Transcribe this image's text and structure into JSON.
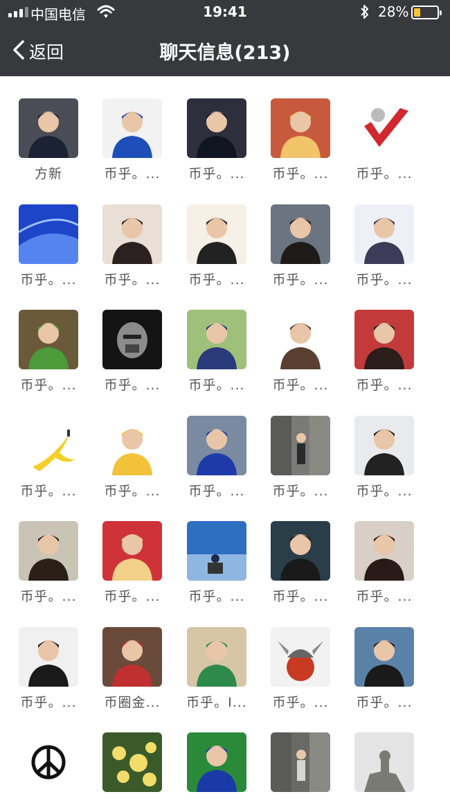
{
  "status": {
    "carrier": "中国电信",
    "time": "19:41",
    "battery_pct": "28%",
    "battery_level": 0.28,
    "icons": [
      "signal-icon",
      "wifi-icon",
      "bluetooth-icon",
      "battery-icon"
    ]
  },
  "nav": {
    "back_label": "返回",
    "title": "聊天信息(213)"
  },
  "members": [
    {
      "name": "方新",
      "avatar": "man-in-suit",
      "bg": "#4a4d55",
      "fg": "#1b2233"
    },
    {
      "name": "币乎。...",
      "avatar": "man-blue-shirt",
      "bg": "#f2f2f2",
      "fg": "#1e4fb8"
    },
    {
      "name": "币乎。...",
      "avatar": "man-glasses-dark",
      "bg": "#2d2f3c",
      "fg": "#111522"
    },
    {
      "name": "币乎。...",
      "avatar": "monkey-king",
      "bg": "#c75a3c",
      "fg": "#f2c46a"
    },
    {
      "name": "币乎。...",
      "avatar": "red-checkmark",
      "bg": "#ffffff",
      "fg": "#d0282e"
    },
    {
      "name": "币乎。...",
      "avatar": "blue-abstract",
      "bg": "#1d45c8",
      "fg": "#6fa0ff"
    },
    {
      "name": "币乎。...",
      "avatar": "girl-portrait",
      "bg": "#e9dfd6",
      "fg": "#2a2120"
    },
    {
      "name": "币乎。...",
      "avatar": "man-bright-room",
      "bg": "#f6f0e6",
      "fg": "#222222"
    },
    {
      "name": "币乎。...",
      "avatar": "woman-portrait",
      "bg": "#6b7480",
      "fg": "#1d1a18"
    },
    {
      "name": "币乎。...",
      "avatar": "cartoon-man",
      "bg": "#eef0f8",
      "fg": "#3c3c58"
    },
    {
      "name": "币乎。...",
      "avatar": "frog-figure",
      "bg": "#6a5a3a",
      "fg": "#4d9a3a"
    },
    {
      "name": "币乎。...",
      "avatar": "robot-head",
      "bg": "#141414",
      "fg": "#8b8b8b"
    },
    {
      "name": "币乎。...",
      "avatar": "girl-cap",
      "bg": "#9fc07a",
      "fg": "#2a3a7a"
    },
    {
      "name": "币乎。...",
      "avatar": "cartoon-girl",
      "bg": "#ffffff",
      "fg": "#5a4030"
    },
    {
      "name": "币乎。...",
      "avatar": "girl-red",
      "bg": "#c23a3a",
      "fg": "#2a1d1a"
    },
    {
      "name": "币乎。...",
      "avatar": "banana",
      "bg": "#ffffff",
      "fg": "#f2d02a"
    },
    {
      "name": "币乎。...",
      "avatar": "cartoon-glasses",
      "bg": "#ffffff",
      "fg": "#f2c23a"
    },
    {
      "name": "币乎。...",
      "avatar": "kid-superman",
      "bg": "#7a8aa0",
      "fg": "#1e3aa8"
    },
    {
      "name": "币乎。...",
      "avatar": "street-photo",
      "bg": "#7a7a78",
      "fg": "#2a2a2a"
    },
    {
      "name": "币乎。...",
      "avatar": "man-glasses-light",
      "bg": "#e8eaec",
      "fg": "#222222"
    },
    {
      "name": "币乎。...",
      "avatar": "woman-outdoor",
      "bg": "#c9c4b6",
      "fg": "#2a2018"
    },
    {
      "name": "币乎。...",
      "avatar": "illustration-girl",
      "bg": "#d0323a",
      "fg": "#f2d08a"
    },
    {
      "name": "币乎。...",
      "avatar": "sky-mountain",
      "bg": "#2f6fc2",
      "fg": "#dfe8f2"
    },
    {
      "name": "币乎。...",
      "avatar": "office-woman",
      "bg": "#2a3e4a",
      "fg": "#1a1a1a"
    },
    {
      "name": "币乎。...",
      "avatar": "woman-smile",
      "bg": "#d8cfc6",
      "fg": "#2a1a18"
    },
    {
      "name": "币乎。...",
      "avatar": "man-glasses-white",
      "bg": "#f0f0f0",
      "fg": "#1a1a1a"
    },
    {
      "name": "币圈金...",
      "avatar": "man-dinner",
      "bg": "#6a4a3a",
      "fg": "#c03030"
    },
    {
      "name": "币乎。I...",
      "avatar": "success-kid",
      "bg": "#d6c6a6",
      "fg": "#2e8a4a"
    },
    {
      "name": "币乎。...",
      "avatar": "viking-helmet",
      "bg": "#f2f2f2",
      "fg": "#c83a22"
    },
    {
      "name": "币乎。...",
      "avatar": "man-seaside",
      "bg": "#5a82a8",
      "fg": "#1a1a1a"
    },
    {
      "name": "",
      "avatar": "peace-sign",
      "bg": "#ffffff",
      "fg": "#111111"
    },
    {
      "name": "",
      "avatar": "yellow-flowers",
      "bg": "#3a5a2a",
      "fg": "#f2dc6a"
    },
    {
      "name": "",
      "avatar": "soccer-player",
      "bg": "#2a8a3a",
      "fg": "#1a3aa8"
    },
    {
      "name": "",
      "avatar": "billboard-street",
      "bg": "#6a6a64",
      "fg": "#d6d6d0"
    },
    {
      "name": "",
      "avatar": "statue-rock",
      "bg": "#e4e4e4",
      "fg": "#7a7a74"
    }
  ]
}
